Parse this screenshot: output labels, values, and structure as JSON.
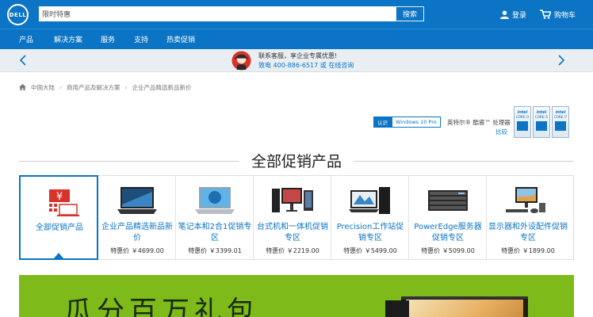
{
  "header": {
    "logo_text": "DELL",
    "search_placeholder": "限时特惠",
    "search_button": "搜索",
    "login": "登录",
    "cart": "购物车"
  },
  "nav": {
    "items": [
      "产品",
      "解决方案",
      "服务",
      "支持",
      "热卖促销"
    ]
  },
  "contact": {
    "line1": "联系客服，享企业专属优惠!",
    "phone": "致电 400-886-6517",
    "sep": " 或 ",
    "chat": "在线咨询"
  },
  "breadcrumb": {
    "items": [
      "中国大陆",
      "商用产品及解决方案",
      "企业产品精选新品新价"
    ]
  },
  "badges": {
    "win_a": "认识",
    "win_b": "Windows 10 Pro",
    "intel": "英特尔® 酷睿™ 处理器",
    "compare": "比较",
    "chips": [
      "CORE i3",
      "CORE i5",
      "CORE i7"
    ],
    "chip_brand": "intel"
  },
  "section": {
    "title": "全部促销产品"
  },
  "cards": [
    {
      "name": "全部促销产品",
      "price": ""
    },
    {
      "name": "企业产品精选新品新价",
      "price": "特惠价 ￥4699.00"
    },
    {
      "name": "笔记本和2合1促销专区",
      "price": "特惠价 ￥3399.01"
    },
    {
      "name": "台式机和一体机促销专区",
      "price": "特惠价 ￥2219.00"
    },
    {
      "name": "Precision工作站促销专区",
      "price": "特惠价 ￥5499.00"
    },
    {
      "name": "PowerEdge服务器促销专区",
      "price": "特惠价 ￥5099.00"
    },
    {
      "name": "显示器和外设配件促销专区",
      "price": "特惠价 ￥1899.00"
    }
  ],
  "banner": {
    "headline": "瓜分百万礼包"
  },
  "colors": {
    "brand_blue": "#0b74c4",
    "banner_green": "#7dba1a",
    "contact_bg": "#e9eef2"
  }
}
